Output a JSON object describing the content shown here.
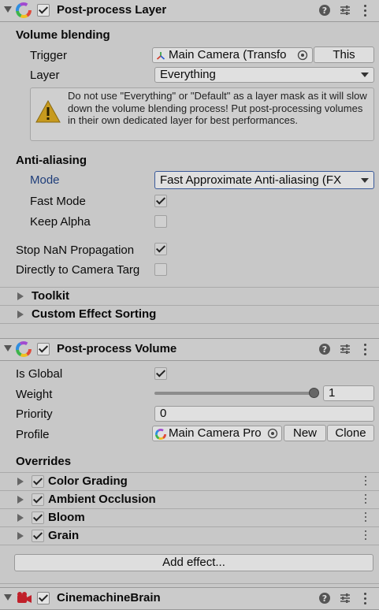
{
  "postprocess_layer": {
    "title": "Post-process Layer",
    "volume_blending": {
      "heading": "Volume blending",
      "trigger_label": "Trigger",
      "trigger_value": "Main Camera (Transfo",
      "this_button": "This",
      "layer_label": "Layer",
      "layer_value": "Everything",
      "warning": "Do not use \"Everything\" or \"Default\" as a layer mask as it will slow down the volume blending process! Put post-processing volumes in their own dedicated layer for best performances."
    },
    "anti_aliasing": {
      "heading": "Anti-aliasing",
      "mode_label": "Mode",
      "mode_value": "Fast Approximate Anti-aliasing (FX",
      "fast_mode_label": "Fast Mode",
      "fast_mode_checked": true,
      "keep_alpha_label": "Keep Alpha",
      "keep_alpha_checked": false
    },
    "stop_nan_label": "Stop NaN Propagation",
    "stop_nan_checked": true,
    "directly_to_camera_label": "Directly to Camera Targ",
    "directly_to_camera_checked": false,
    "foldouts": [
      "Toolkit",
      "Custom Effect Sorting"
    ]
  },
  "postprocess_volume": {
    "title": "Post-process Volume",
    "is_global_label": "Is Global",
    "is_global_checked": true,
    "weight_label": "Weight",
    "weight_value": "1",
    "weight_fraction": 1.0,
    "priority_label": "Priority",
    "priority_value": "0",
    "profile_label": "Profile",
    "profile_value": "Main Camera Pro",
    "new_button": "New",
    "clone_button": "Clone",
    "overrides_heading": "Overrides",
    "overrides": [
      {
        "label": "Color Grading",
        "checked": true
      },
      {
        "label": "Ambient Occlusion",
        "checked": true
      },
      {
        "label": "Bloom",
        "checked": true
      },
      {
        "label": "Grain",
        "checked": true
      }
    ],
    "add_effect_button": "Add effect..."
  },
  "cinemachine_brain": {
    "title": "CinemachineBrain"
  },
  "colors": {
    "panel_bg": "#c8c8c8",
    "mode_label": "#1f3e7a",
    "warning_yellow": "#c79a1e"
  }
}
